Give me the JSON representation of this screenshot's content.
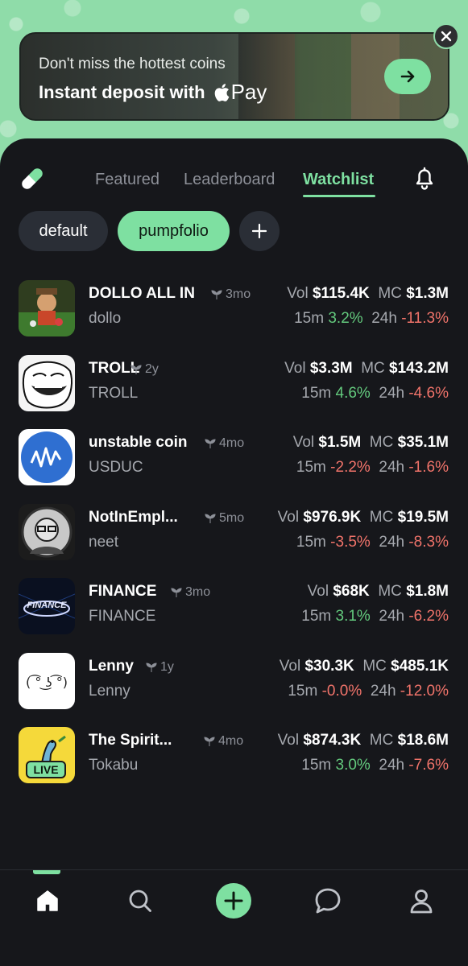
{
  "banner": {
    "line1": "Don't miss the hottest coins",
    "line2": "Instant deposit with",
    "pay_label": "Pay"
  },
  "tabs": [
    {
      "label": "Featured",
      "active": false
    },
    {
      "label": "Leaderboard",
      "active": false
    },
    {
      "label": "Watchlist",
      "active": true
    }
  ],
  "chips": {
    "default_label": "default",
    "pumpfolio_label": "pumpfolio",
    "add_label": "+"
  },
  "coins": [
    {
      "name": "DOLLO ALL IN",
      "ticker": "dollo",
      "age": "3mo",
      "vol": "$115.4K",
      "mc": "$1.3M",
      "m15": "3.2%",
      "h24": "-11.3%"
    },
    {
      "name": "TROLL",
      "ticker": "TROLL",
      "age": "2y",
      "vol": "$3.3M",
      "mc": "$143.2M",
      "m15": "4.6%",
      "h24": "-4.6%"
    },
    {
      "name": "unstable coin",
      "ticker": "USDUC",
      "age": "4mo",
      "vol": "$1.5M",
      "mc": "$35.1M",
      "m15": "-2.2%",
      "h24": "-1.6%"
    },
    {
      "name": "NotInEmpl...",
      "ticker": "neet",
      "age": "5mo",
      "vol": "$976.9K",
      "mc": "$19.5M",
      "m15": "-3.5%",
      "h24": "-8.3%"
    },
    {
      "name": "FINANCE",
      "ticker": "FINANCE",
      "age": "3mo",
      "vol": "$68K",
      "mc": "$1.8M",
      "m15": "3.1%",
      "h24": "-6.2%"
    },
    {
      "name": "Lenny",
      "ticker": "Lenny",
      "age": "1y",
      "vol": "$30.3K",
      "mc": "$485.1K",
      "m15": "-0.0%",
      "h24": "-12.0%"
    },
    {
      "name": "The Spirit...",
      "ticker": "Tokabu",
      "age": "4mo",
      "vol": "$874.3K",
      "mc": "$18.6M",
      "m15": "3.0%",
      "h24": "-7.6%"
    }
  ],
  "labels": {
    "vol": "Vol",
    "mc": "MC",
    "m15": "15m",
    "h24": "24h",
    "live": "LIVE",
    "lenny_face": "( ͡° ͜ʖ ͡°)",
    "finance_logo": "FINANCE"
  },
  "colors": {
    "accent": "#7ee0a1",
    "positive": "#63c97d",
    "negative": "#f0736a",
    "panel_bg": "#16171b"
  },
  "nav": [
    "home-icon",
    "search-icon",
    "plus-icon",
    "chat-icon",
    "profile-icon"
  ]
}
